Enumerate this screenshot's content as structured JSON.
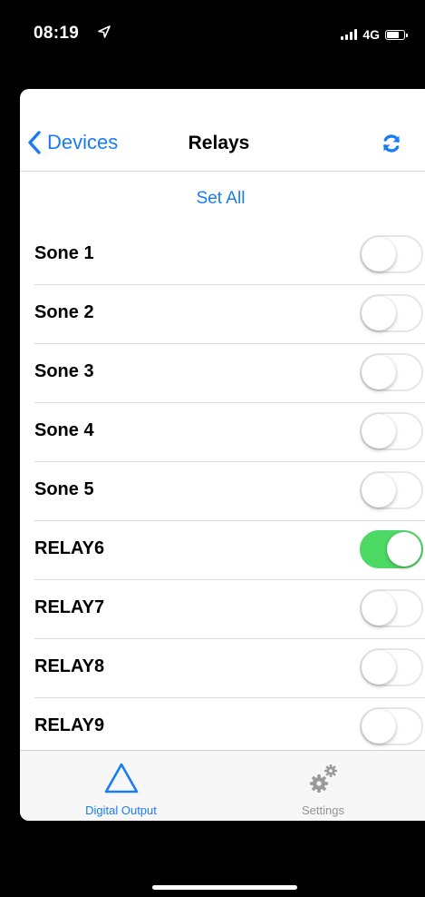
{
  "status_bar": {
    "time": "08:19",
    "network": "4G",
    "battery_level": 0.8
  },
  "nav": {
    "back_label": "Devices",
    "title": "Relays",
    "refresh_icon": "refresh-icon",
    "accent_color": "#1a7cf5"
  },
  "set_all_label": "Set All",
  "relays": [
    {
      "label": "Sone 1",
      "on": false
    },
    {
      "label": "Sone 2",
      "on": false
    },
    {
      "label": "Sone 3",
      "on": false
    },
    {
      "label": "Sone 4",
      "on": false
    },
    {
      "label": "Sone 5",
      "on": false
    },
    {
      "label": "RELAY6",
      "on": true
    },
    {
      "label": "RELAY7",
      "on": false
    },
    {
      "label": "RELAY8",
      "on": false
    },
    {
      "label": "RELAY9",
      "on": false
    }
  ],
  "tabs": [
    {
      "label": "Digital Output",
      "icon": "triangle-icon",
      "active": true
    },
    {
      "label": "Settings",
      "icon": "gears-icon",
      "active": false
    }
  ],
  "colors": {
    "toggle_on": "#4cd964",
    "tab_inactive": "#929292"
  }
}
